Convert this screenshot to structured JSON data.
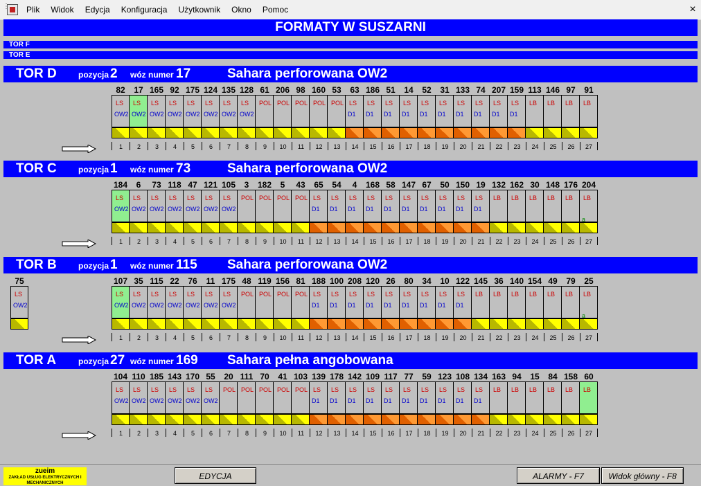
{
  "menu": {
    "items": [
      "Plik",
      "Widok",
      "Edycja",
      "Konfiguracja",
      "Użytkownik",
      "Okno",
      "Pomoc"
    ],
    "close": "×"
  },
  "title": "FORMATY W SUSZARNI",
  "small_tracks": [
    "TOR F",
    "TOR E"
  ],
  "labels": {
    "pozycja": "pozycja",
    "woz": "wóz numer"
  },
  "tracks": [
    {
      "name": "TOR D",
      "pozycja": "2",
      "woz": "17",
      "product": "Sahara perforowana OW2",
      "cars": [
        {
          "num": "82",
          "t1": "LS",
          "t2": "OW2",
          "fill": "y"
        },
        {
          "num": "17",
          "t1": "LS",
          "t2": "OW2",
          "fill": "y",
          "green": true
        },
        {
          "num": "165",
          "t1": "LS",
          "t2": "OW2",
          "fill": "y"
        },
        {
          "num": "92",
          "t1": "LS",
          "t2": "OW2",
          "fill": "y"
        },
        {
          "num": "175",
          "t1": "LS",
          "t2": "OW2",
          "fill": "y"
        },
        {
          "num": "124",
          "t1": "LS",
          "t2": "OW2",
          "fill": "y"
        },
        {
          "num": "135",
          "t1": "LS",
          "t2": "OW2",
          "fill": "y"
        },
        {
          "num": "128",
          "t1": "LS",
          "t2": "OW2",
          "fill": "y"
        },
        {
          "num": "61",
          "t1": "POL",
          "t2": "",
          "fill": "y"
        },
        {
          "num": "206",
          "t1": "POL",
          "t2": "",
          "fill": "y"
        },
        {
          "num": "98",
          "t1": "POL",
          "t2": "",
          "fill": "y"
        },
        {
          "num": "160",
          "t1": "POL",
          "t2": "",
          "fill": "y"
        },
        {
          "num": "53",
          "t1": "POL",
          "t2": "",
          "fill": "y"
        },
        {
          "num": "63",
          "t1": "LS",
          "t2": "D1",
          "fill": "o"
        },
        {
          "num": "186",
          "t1": "LS",
          "t2": "D1",
          "fill": "o"
        },
        {
          "num": "51",
          "t1": "LS",
          "t2": "D1",
          "fill": "o"
        },
        {
          "num": "14",
          "t1": "LS",
          "t2": "D1",
          "fill": "o"
        },
        {
          "num": "52",
          "t1": "LS",
          "t2": "D1",
          "fill": "o"
        },
        {
          "num": "31",
          "t1": "LS",
          "t2": "D1",
          "fill": "o"
        },
        {
          "num": "133",
          "t1": "LS",
          "t2": "D1",
          "fill": "o"
        },
        {
          "num": "74",
          "t1": "LS",
          "t2": "D1",
          "fill": "o"
        },
        {
          "num": "207",
          "t1": "LS",
          "t2": "D1",
          "fill": "o"
        },
        {
          "num": "159",
          "t1": "LS",
          "t2": "D1",
          "fill": "o"
        },
        {
          "num": "113",
          "t1": "LB",
          "t2": "",
          "fill": "y"
        },
        {
          "num": "146",
          "t1": "LB",
          "t2": "",
          "fill": "y"
        },
        {
          "num": "97",
          "t1": "LB",
          "t2": "",
          "fill": "y"
        },
        {
          "num": "91",
          "t1": "LB",
          "t2": "",
          "fill": "y"
        }
      ]
    },
    {
      "name": "TOR C",
      "pozycja": "1",
      "woz": "73",
      "product": "Sahara perforowana OW2",
      "cars": [
        {
          "num": "184",
          "t1": "LS",
          "t2": "OW2",
          "fill": "y",
          "green": true
        },
        {
          "num": "6",
          "t1": "LS",
          "t2": "OW2",
          "fill": "y"
        },
        {
          "num": "73",
          "t1": "LS",
          "t2": "OW2",
          "fill": "y"
        },
        {
          "num": "118",
          "t1": "LS",
          "t2": "OW2",
          "fill": "y"
        },
        {
          "num": "47",
          "t1": "LS",
          "t2": "OW2",
          "fill": "y"
        },
        {
          "num": "121",
          "t1": "LS",
          "t2": "OW2",
          "fill": "y"
        },
        {
          "num": "105",
          "t1": "LS",
          "t2": "OW2",
          "fill": "y"
        },
        {
          "num": "3",
          "t1": "POL",
          "t2": "",
          "fill": "y"
        },
        {
          "num": "182",
          "t1": "POL",
          "t2": "",
          "fill": "y"
        },
        {
          "num": "5",
          "t1": "POL",
          "t2": "",
          "fill": "y"
        },
        {
          "num": "43",
          "t1": "POL",
          "t2": "",
          "fill": "y"
        },
        {
          "num": "65",
          "t1": "LS",
          "t2": "D1",
          "fill": "o"
        },
        {
          "num": "54",
          "t1": "LS",
          "t2": "D1",
          "fill": "o"
        },
        {
          "num": "4",
          "t1": "LS",
          "t2": "D1",
          "fill": "o"
        },
        {
          "num": "168",
          "t1": "LS",
          "t2": "D1",
          "fill": "o"
        },
        {
          "num": "58",
          "t1": "LS",
          "t2": "D1",
          "fill": "o"
        },
        {
          "num": "147",
          "t1": "LS",
          "t2": "D1",
          "fill": "o"
        },
        {
          "num": "67",
          "t1": "LS",
          "t2": "D1",
          "fill": "o"
        },
        {
          "num": "50",
          "t1": "LS",
          "t2": "D1",
          "fill": "o"
        },
        {
          "num": "150",
          "t1": "LS",
          "t2": "D1",
          "fill": "o"
        },
        {
          "num": "19",
          "t1": "LS",
          "t2": "D1",
          "fill": "o"
        },
        {
          "num": "132",
          "t1": "LB",
          "t2": "",
          "fill": "y"
        },
        {
          "num": "162",
          "t1": "LB",
          "t2": "",
          "fill": "y"
        },
        {
          "num": "30",
          "t1": "LB",
          "t2": "",
          "fill": "y"
        },
        {
          "num": "148",
          "t1": "LB",
          "t2": "",
          "fill": "y"
        },
        {
          "num": "176",
          "t1": "LB",
          "t2": "",
          "fill": "y"
        },
        {
          "num": "204",
          "t1": "LB",
          "t2": "",
          "t3": "a",
          "fill": "y"
        }
      ]
    },
    {
      "name": "TOR B",
      "pozycja": "1",
      "woz": "115",
      "product": "Sahara perforowana OW2",
      "extra": {
        "num": "75",
        "t1": "LS",
        "t2": "OW2",
        "fill": "y"
      },
      "cars": [
        {
          "num": "107",
          "t1": "LS",
          "t2": "OW2",
          "fill": "y",
          "green": true
        },
        {
          "num": "35",
          "t1": "LS",
          "t2": "OW2",
          "fill": "y"
        },
        {
          "num": "115",
          "t1": "LS",
          "t2": "OW2",
          "fill": "y"
        },
        {
          "num": "22",
          "t1": "LS",
          "t2": "OW2",
          "fill": "y"
        },
        {
          "num": "76",
          "t1": "LS",
          "t2": "OW2",
          "fill": "y"
        },
        {
          "num": "11",
          "t1": "LS",
          "t2": "OW2",
          "fill": "y"
        },
        {
          "num": "175",
          "t1": "LS",
          "t2": "OW2",
          "fill": "y"
        },
        {
          "num": "48",
          "t1": "POL",
          "t2": "",
          "fill": "y"
        },
        {
          "num": "119",
          "t1": "POL",
          "t2": "",
          "fill": "y"
        },
        {
          "num": "156",
          "t1": "POL",
          "t2": "",
          "fill": "y"
        },
        {
          "num": "81",
          "t1": "POL",
          "t2": "",
          "fill": "y"
        },
        {
          "num": "188",
          "t1": "LS",
          "t2": "D1",
          "fill": "o"
        },
        {
          "num": "100",
          "t1": "LS",
          "t2": "D1",
          "fill": "o"
        },
        {
          "num": "208",
          "t1": "LS",
          "t2": "D1",
          "fill": "o"
        },
        {
          "num": "120",
          "t1": "LS",
          "t2": "D1",
          "fill": "o"
        },
        {
          "num": "26",
          "t1": "LS",
          "t2": "D1",
          "fill": "o"
        },
        {
          "num": "80",
          "t1": "LS",
          "t2": "D1",
          "fill": "o"
        },
        {
          "num": "34",
          "t1": "LS",
          "t2": "D1",
          "fill": "o"
        },
        {
          "num": "10",
          "t1": "LS",
          "t2": "D1",
          "fill": "o"
        },
        {
          "num": "122",
          "t1": "LS",
          "t2": "D1",
          "fill": "o"
        },
        {
          "num": "145",
          "t1": "LB",
          "t2": "",
          "fill": "y"
        },
        {
          "num": "36",
          "t1": "LB",
          "t2": "",
          "fill": "y"
        },
        {
          "num": "140",
          "t1": "LB",
          "t2": "",
          "fill": "y"
        },
        {
          "num": "154",
          "t1": "LB",
          "t2": "",
          "fill": "y"
        },
        {
          "num": "49",
          "t1": "LB",
          "t2": "",
          "fill": "y"
        },
        {
          "num": "79",
          "t1": "LB",
          "t2": "",
          "fill": "y"
        },
        {
          "num": "25",
          "t1": "LB",
          "t2": "",
          "t3": "a",
          "fill": "y"
        }
      ]
    },
    {
      "name": "TOR A",
      "pozycja": "27",
      "woz": "169",
      "product": "Sahara pełna angobowana",
      "cars": [
        {
          "num": "104",
          "t1": "LS",
          "t2": "OW2",
          "fill": "y"
        },
        {
          "num": "110",
          "t1": "LS",
          "t2": "OW2",
          "fill": "y"
        },
        {
          "num": "185",
          "t1": "LS",
          "t2": "OW2",
          "fill": "y"
        },
        {
          "num": "143",
          "t1": "LS",
          "t2": "OW2",
          "fill": "y"
        },
        {
          "num": "170",
          "t1": "LS",
          "t2": "OW2",
          "fill": "y"
        },
        {
          "num": "55",
          "t1": "LS",
          "t2": "OW2",
          "fill": "y"
        },
        {
          "num": "20",
          "t1": "POL",
          "t2": "",
          "fill": "y"
        },
        {
          "num": "111",
          "t1": "POL",
          "t2": "",
          "fill": "y"
        },
        {
          "num": "70",
          "t1": "POL",
          "t2": "",
          "fill": "y"
        },
        {
          "num": "41",
          "t1": "POL",
          "t2": "",
          "fill": "y"
        },
        {
          "num": "103",
          "t1": "POL",
          "t2": "",
          "fill": "y"
        },
        {
          "num": "139",
          "t1": "LS",
          "t2": "D1",
          "fill": "o"
        },
        {
          "num": "178",
          "t1": "LS",
          "t2": "D1",
          "fill": "o"
        },
        {
          "num": "142",
          "t1": "LS",
          "t2": "D1",
          "fill": "o"
        },
        {
          "num": "109",
          "t1": "LS",
          "t2": "D1",
          "fill": "o"
        },
        {
          "num": "117",
          "t1": "LS",
          "t2": "D1",
          "fill": "o"
        },
        {
          "num": "77",
          "t1": "LS",
          "t2": "D1",
          "fill": "o"
        },
        {
          "num": "59",
          "t1": "LS",
          "t2": "D1",
          "fill": "o"
        },
        {
          "num": "123",
          "t1": "LS",
          "t2": "D1",
          "fill": "o"
        },
        {
          "num": "108",
          "t1": "LS",
          "t2": "D1",
          "fill": "o"
        },
        {
          "num": "134",
          "t1": "LS",
          "t2": "D1",
          "fill": "o"
        },
        {
          "num": "163",
          "t1": "LB",
          "t2": "",
          "fill": "y"
        },
        {
          "num": "94",
          "t1": "LB",
          "t2": "",
          "fill": "y"
        },
        {
          "num": "15",
          "t1": "LB",
          "t2": "",
          "fill": "y"
        },
        {
          "num": "84",
          "t1": "LB",
          "t2": "",
          "fill": "y"
        },
        {
          "num": "158",
          "t1": "LB",
          "t2": "",
          "fill": "y"
        },
        {
          "num": "60",
          "t1": "LB",
          "t2": "",
          "fill": "y",
          "green": true
        }
      ]
    }
  ],
  "positions": [
    "1",
    "2",
    "3",
    "4",
    "5",
    "6",
    "7",
    "8",
    "9",
    "10",
    "11",
    "12",
    "13",
    "14",
    "15",
    "16",
    "17",
    "18",
    "19",
    "20",
    "21",
    "22",
    "23",
    "24",
    "25",
    "26",
    "27"
  ],
  "footer": {
    "logo_title": "zueim",
    "logo_sub": "ZAKŁAD USŁUG ELEKTRYCZNYCH I MECHANICZNYCH",
    "edit_button": "EDYCJA",
    "alarms_button": "ALARMY - F7",
    "main_view_button": "Widok główny - F8"
  }
}
